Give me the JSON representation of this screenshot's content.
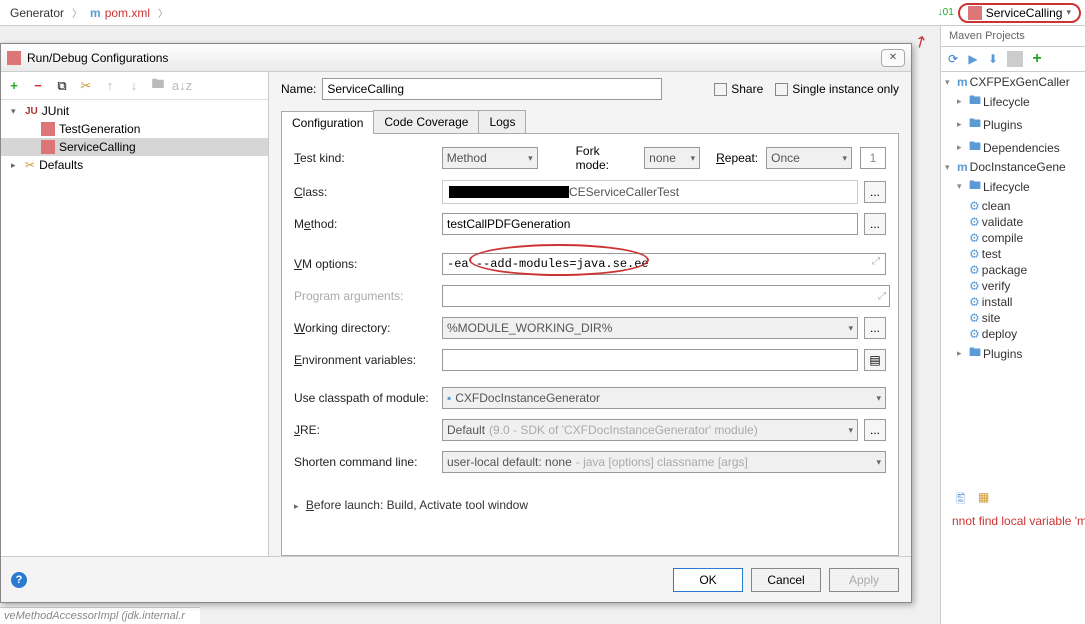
{
  "breadcrumb": {
    "project": "Generator",
    "file": "pom.xml"
  },
  "topRight": {
    "runConfig": "ServiceCalling"
  },
  "maven": {
    "title": "Maven Projects",
    "root": "CXFPExGenCaller",
    "nodes": {
      "lifecycle": "Lifecycle",
      "plugins": "Plugins",
      "dependencies": "Dependencies",
      "docInstance": "DocInstanceGene",
      "lifecycle2": "Lifecycle",
      "goals": [
        "clean",
        "validate",
        "compile",
        "test",
        "package",
        "verify",
        "install",
        "site",
        "deploy"
      ],
      "plugins2": "Plugins"
    }
  },
  "error": "nnot find local variable 'modul",
  "status": "veMethodAccessorImpl (jdk.internal.r",
  "dialog": {
    "title": "Run/Debug Configurations",
    "tree": {
      "junit": "JUnit",
      "items": [
        "TestGeneration",
        "ServiceCalling"
      ],
      "defaults": "Defaults"
    },
    "nameLabel": "Name:",
    "name": "ServiceCalling",
    "share": "Share",
    "single": "Single instance only",
    "tabs": {
      "configuration": "Configuration",
      "coverage": "Code Coverage",
      "logs": "Logs"
    },
    "form": {
      "testKind": "Test kind:",
      "testKindVal": "Method",
      "forkMode": "Fork mode:",
      "forkVal": "none",
      "repeat": "Repeat:",
      "repeatVal": "Once",
      "repeatN": "1",
      "class": "Class:",
      "classVal": "CEServiceCallerTest",
      "method": "Method:",
      "methodVal": "testCallPDFGeneration",
      "vm": "VM options:",
      "vmVal": "-ea --add-modules=java.se.ee",
      "prog": "Program arguments:",
      "wd": "Working directory:",
      "wdVal": "%MODULE_WORKING_DIR%",
      "env": "Environment variables:",
      "cp": "Use classpath of module:",
      "cpVal": "CXFDocInstanceGenerator",
      "jre": "JRE:",
      "jreVal": "Default",
      "jreHint": "(9.0 - SDK of 'CXFDocInstanceGenerator' module)",
      "scl": "Shorten command line:",
      "sclVal": "user-local default: none",
      "sclHint": "- java [options] classname [args]"
    },
    "before": "Before launch: Build, Activate tool window",
    "buttons": {
      "ok": "OK",
      "cancel": "Cancel",
      "apply": "Apply"
    }
  }
}
